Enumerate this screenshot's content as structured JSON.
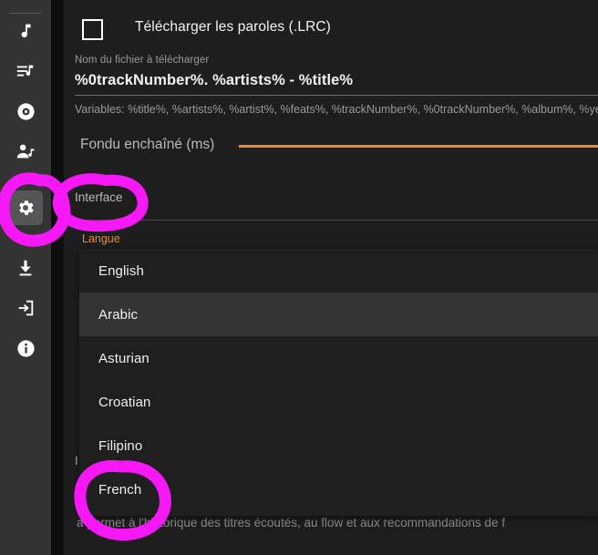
{
  "app": {
    "background": "#1e1e1e",
    "rail_background": "#333333",
    "accent": "#f08a28",
    "annotation_color": "#f618f6"
  },
  "sidebar": {
    "items": [
      {
        "icon": "music-note-icon",
        "name": "songs",
        "active": false
      },
      {
        "icon": "playlist-icon",
        "name": "playlists",
        "active": false
      },
      {
        "icon": "album-disc-icon",
        "name": "albums",
        "active": false
      },
      {
        "icon": "artist-icon",
        "name": "artists",
        "active": false
      },
      {
        "icon": "gear-icon",
        "name": "settings",
        "active": true
      },
      {
        "icon": "download-icon",
        "name": "downloads",
        "active": false
      },
      {
        "icon": "login-icon",
        "name": "login",
        "active": false
      },
      {
        "icon": "info-icon",
        "name": "about",
        "active": false
      }
    ]
  },
  "settings": {
    "lyrics_checkbox": {
      "label": "Télécharger les paroles (.LRC)",
      "checked": false
    },
    "filename": {
      "label": "Nom du fichier à télécharger",
      "value": "%0trackNumber%. %artists% - %title%",
      "hint": "Variables: %title%, %artists%, %artist%, %feats%, %trackNumber%, %0trackNumber%, %album%, %year%, %lab"
    },
    "crossfade": {
      "label": "Fondu enchaîné (ms)"
    },
    "tab": {
      "label": "Interface"
    },
    "language_caption": "Langue",
    "sub_heading": "I",
    "body_note": "a permet à l'historique des titres écoutés, au flow et aux recommandations de f"
  },
  "language_dropdown": {
    "selected": "Arabic",
    "options": [
      {
        "label": "English",
        "selected": false
      },
      {
        "label": "Arabic",
        "selected": true
      },
      {
        "label": "Asturian",
        "selected": false
      },
      {
        "label": "Croatian",
        "selected": false
      },
      {
        "label": "Filipino",
        "selected": false
      },
      {
        "label": "French",
        "selected": false
      }
    ]
  },
  "annotations": [
    {
      "name": "gear-icon-circle",
      "shape": "circle"
    },
    {
      "name": "interface-tab-circle",
      "shape": "circle"
    },
    {
      "name": "french-option-circle",
      "shape": "circle"
    }
  ]
}
